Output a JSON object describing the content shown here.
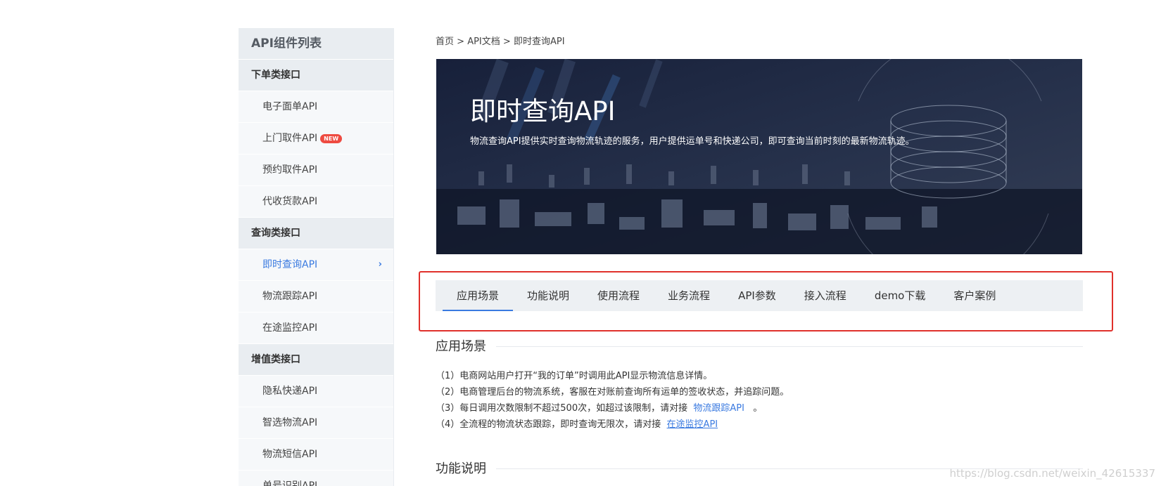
{
  "sidebar": {
    "title": "API组件列表",
    "groups": [
      {
        "label": "下单类接口",
        "items": [
          {
            "label": "电子面单API"
          },
          {
            "label": "上门取件API",
            "badge": "NEW"
          },
          {
            "label": "预约取件API"
          },
          {
            "label": "代收货款API"
          }
        ]
      },
      {
        "label": "查询类接口",
        "items": [
          {
            "label": "即时查询API",
            "active": true,
            "indicator": "chevron-right"
          },
          {
            "label": "物流跟踪API"
          },
          {
            "label": "在途监控API"
          }
        ]
      },
      {
        "label": "增值类接口",
        "items": [
          {
            "label": "隐私快递API"
          },
          {
            "label": "智选物流API"
          },
          {
            "label": "物流短信API"
          },
          {
            "label": "单号识别API"
          }
        ]
      }
    ]
  },
  "breadcrumb": {
    "items": [
      "首页",
      "API文档",
      "即时查询API"
    ],
    "separator": ">"
  },
  "banner": {
    "title": "即时查询API",
    "description": "物流查询API提供实时查询物流轨迹的服务，用户提供运单号和快递公司，即可查询当前时刻的最新物流轨迹。"
  },
  "tabs": {
    "items": [
      "应用场景",
      "功能说明",
      "使用流程",
      "业务流程",
      "API参数",
      "接入流程",
      "demo下载",
      "客户案例"
    ],
    "active": "应用场景"
  },
  "sections": {
    "scenario": {
      "title": "应用场景",
      "lines": [
        {
          "text": "（1）电商网站用户打开“我的订单”时调用此API显示物流信息详情。"
        },
        {
          "text": "（2）电商管理后台的物流系统，客服在对账前查询所有运单的签收状态，并追踪问题。"
        },
        {
          "text": "（3）每日调用次数限制不超过500次，如超过该限制，请对接",
          "link": "物流跟踪API",
          "suffix": "。"
        },
        {
          "text": "（4）全流程的物流状态跟踪，即时查询无限次，请对接",
          "link": "在途监控API"
        }
      ]
    },
    "features": {
      "title": "功能说明"
    }
  },
  "watermark": "https://blog.csdn.net/weixin_42615337",
  "colors": {
    "accent": "#3a7ae0",
    "badge": "#ee4b41",
    "highlight_border": "#e0302b",
    "banner_bg": "#1d2740",
    "sidebar_header_bg": "#e9edf1",
    "sidebar_item_bg": "#f6f8fa",
    "tab_bar_bg": "#edf0f3"
  },
  "icons": {
    "active_item_indicator": "chevron-right-icon",
    "banner_graphic": "database-cylinder-icon"
  }
}
